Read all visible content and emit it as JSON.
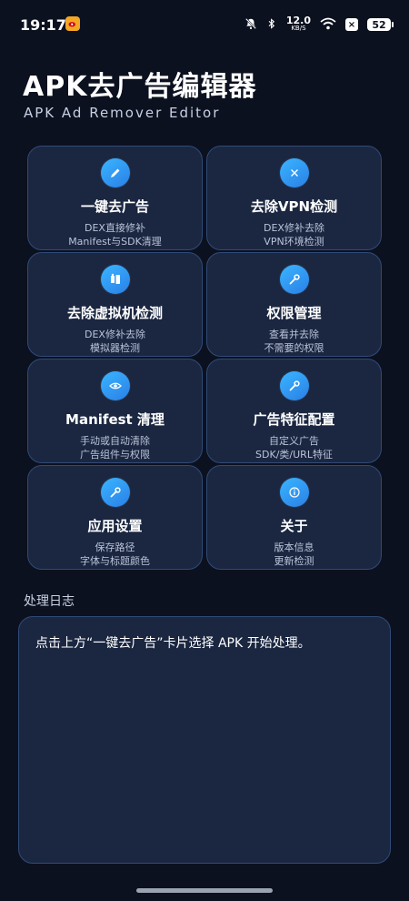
{
  "status": {
    "time": "19:17",
    "net_speed_value": "12.0",
    "net_speed_unit": "KB/S",
    "x_badge": "×",
    "battery": "52"
  },
  "header": {
    "title": "APK去广告编辑器",
    "subtitle": "APK Ad Remover Editor"
  },
  "cards": [
    {
      "title": "一键去广告",
      "desc1": "DEX直接修补",
      "desc2": "Manifest与SDK清理",
      "icon": "pencil-icon"
    },
    {
      "title": "去除VPN检测",
      "desc1": "DEX修补去除",
      "desc2": "VPN环境检测",
      "icon": "close-icon"
    },
    {
      "title": "去除虚拟机检测",
      "desc1": "DEX修补去除",
      "desc2": "模拟器检测",
      "icon": "device-icon"
    },
    {
      "title": "权限管理",
      "desc1": "查看并去除",
      "desc2": "不需要的权限",
      "icon": "wrench-icon"
    },
    {
      "title": "Manifest 清理",
      "desc1": "手动或自动清除",
      "desc2": "广告组件与权限",
      "icon": "eye-icon"
    },
    {
      "title": "广告特征配置",
      "desc1": "自定义广告",
      "desc2": "SDK/类/URL特征",
      "icon": "wrench-icon"
    },
    {
      "title": "应用设置",
      "desc1": "保存路径",
      "desc2": "字体与标题颜色",
      "icon": "wrench-icon"
    },
    {
      "title": "关于",
      "desc1": "版本信息",
      "desc2": "更新检测",
      "icon": "info-icon"
    }
  ],
  "log": {
    "label": "处理日志",
    "text": "点击上方“一键去广告”卡片选择 APK 开始处理。"
  },
  "colors": {
    "background": "#0c111f",
    "card": "#1b2741",
    "card_border": "#304a78",
    "accent": "#2a9bf5"
  }
}
